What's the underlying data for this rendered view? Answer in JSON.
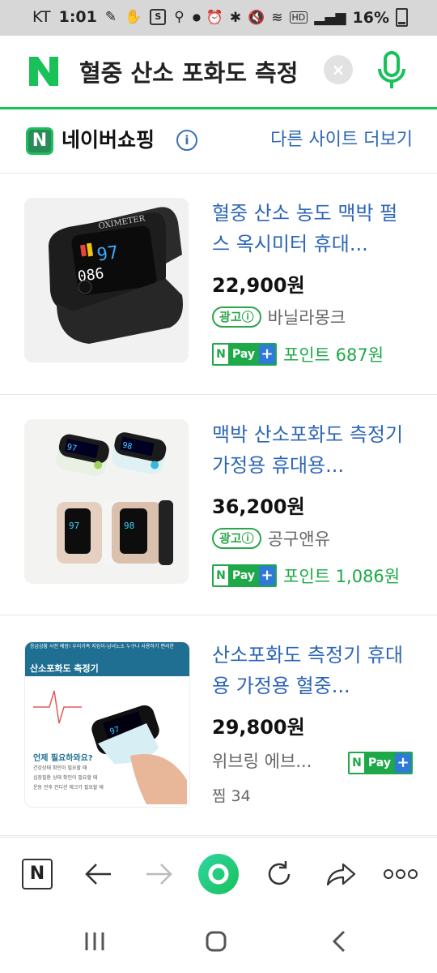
{
  "status": {
    "carrier": "KT",
    "time": "1:01",
    "battery": "16%",
    "network_badge": "HD"
  },
  "search": {
    "query": "혈중 산소 포화도 측정",
    "logo_letter": "N",
    "clear_symbol": "×"
  },
  "shopping": {
    "logo_letter": "N",
    "title": "네이버쇼핑",
    "info_symbol": "i",
    "more_link": "다른 사이트 더보기"
  },
  "products": [
    {
      "title": "혈중 산소 농도 맥박 펄스 옥시미터 휴대...",
      "price": "22,900원",
      "ad_badge": "광고ⓘ",
      "seller": "바닐라몽크",
      "pay_label": "Pay",
      "points": "포인트 687원",
      "thumb_text": "OXIMETER"
    },
    {
      "title": "맥박 산소포화도 측정기 가정용 휴대용...",
      "price": "36,200원",
      "ad_badge": "광고ⓘ",
      "seller": "공구앤유",
      "pay_label": "Pay",
      "points": "포인트 1,086원"
    },
    {
      "title": "산소포화도 측정기 휴대용 가정용 혈중...",
      "price": "29,800원",
      "seller": "위브링 에브...",
      "pay_label": "Pay",
      "zzim": "찜 34",
      "thumb_banner_small": "응급상황 사전 예방! 우리가족 지킴이-남녀노소 누구나 사용하기 편리한",
      "thumb_banner_title": "산소포화도 측정기",
      "thumb_question": "언제 필요하와요?",
      "thumb_check_1": "건강상태 확인이 필요할 때",
      "thumb_check_2": "심장질환 상태 확인이 필요할 때",
      "thumb_check_3": "운동 전후 컨디션 체크가 필요할 때"
    }
  ],
  "browser_bar": {
    "home_letter": "N"
  },
  "colors": {
    "naver_green": "#19c159",
    "link_blue": "#2d66b6",
    "pay_green": "#1da948"
  }
}
